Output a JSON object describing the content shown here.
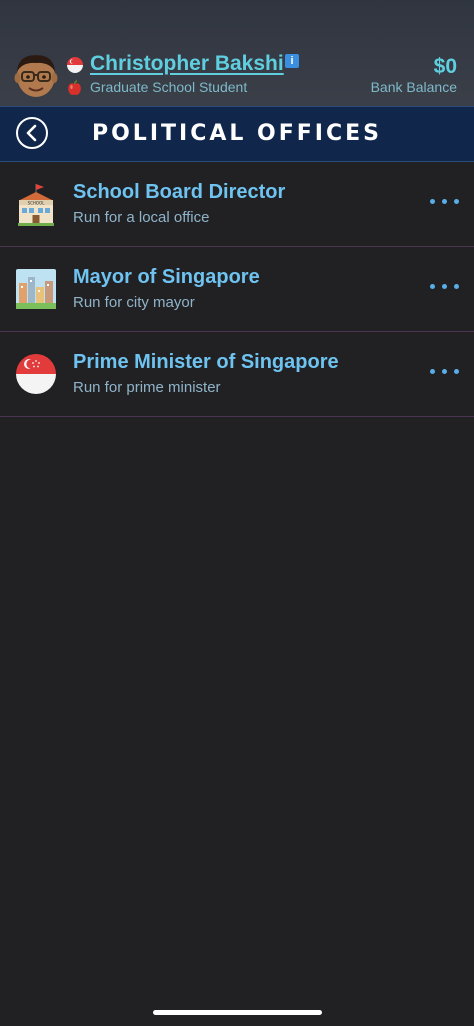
{
  "player": {
    "name": "Christopher Bakshi",
    "status": "Graduate School Student",
    "avatar_icon": "avatar-face-with-glasses",
    "flag_icon": "singapore-flag-icon",
    "status_icon": "apple-icon"
  },
  "bank": {
    "amount": "$0",
    "label": "Bank Balance"
  },
  "header": {
    "title": "POLITICAL OFFICES",
    "back_icon": "chevron-left-icon"
  },
  "offices": [
    {
      "title": "School Board Director",
      "subtitle": "Run for a local office",
      "icon": "school-icon"
    },
    {
      "title": "Mayor of Singapore",
      "subtitle": "Run for city mayor",
      "icon": "city-icon"
    },
    {
      "title": "Prime Minister of Singapore",
      "subtitle": "Run for prime minister",
      "icon": "singapore-flag-icon"
    }
  ],
  "colors": {
    "accent": "#5fcfe0",
    "title_blue": "#6ec3f0",
    "header_bg": "#10264a",
    "background": "#212124"
  }
}
